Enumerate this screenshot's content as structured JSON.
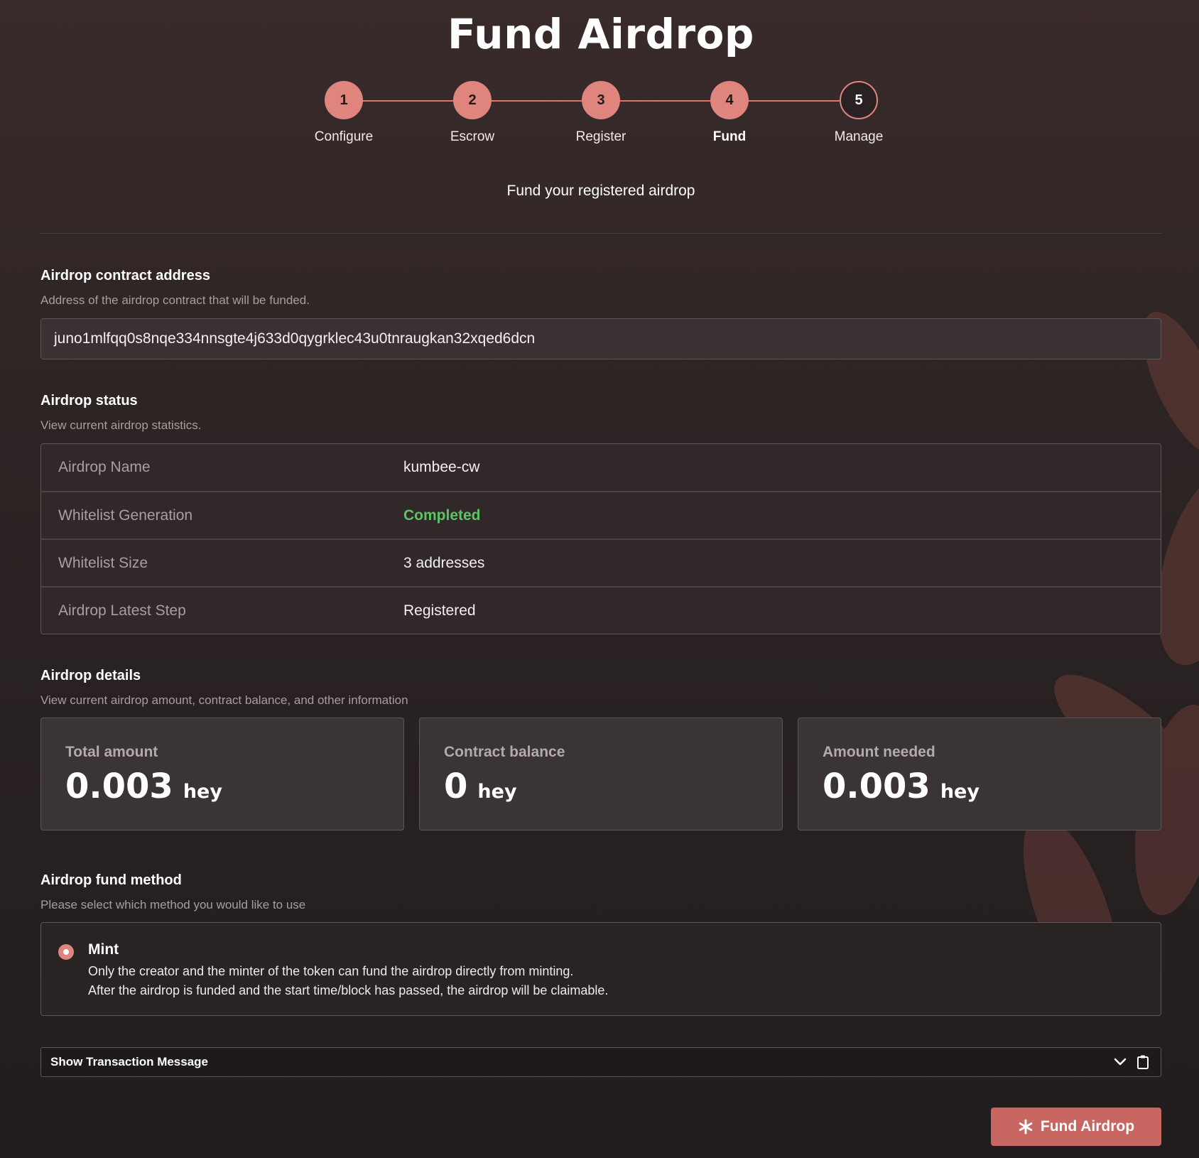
{
  "page": {
    "title": "Fund Airdrop",
    "subtitle": "Fund your registered airdrop"
  },
  "stepper": {
    "steps": [
      {
        "number": "1",
        "label": "Configure",
        "state": "done"
      },
      {
        "number": "2",
        "label": "Escrow",
        "state": "done"
      },
      {
        "number": "3",
        "label": "Register",
        "state": "done"
      },
      {
        "number": "4",
        "label": "Fund",
        "state": "active"
      },
      {
        "number": "5",
        "label": "Manage",
        "state": "upcoming"
      }
    ]
  },
  "contract": {
    "title": "Airdrop contract address",
    "description": "Address of the airdrop contract that will be funded.",
    "address": "juno1mlfqq0s8nqe334nnsgte4j633d0qygrklec43u0tnraugkan32xqed6dcn"
  },
  "status": {
    "title": "Airdrop status",
    "description": "View current airdrop statistics.",
    "rows": [
      {
        "key": "Airdrop Name",
        "value": "kumbee-cw"
      },
      {
        "key": "Whitelist Generation",
        "value": "Completed"
      },
      {
        "key": "Whitelist Size",
        "value": "3 addresses"
      },
      {
        "key": "Airdrop Latest Step",
        "value": "Registered"
      }
    ]
  },
  "details": {
    "title": "Airdrop details",
    "description": "View current airdrop amount, contract balance, and other information",
    "cards": [
      {
        "label": "Total amount",
        "value": "0.003",
        "unit": "hey"
      },
      {
        "label": "Contract balance",
        "value": "0",
        "unit": "hey"
      },
      {
        "label": "Amount needed",
        "value": "0.003",
        "unit": "hey"
      }
    ]
  },
  "fund_method": {
    "title": "Airdrop fund method",
    "description": "Please select which method you would like to use",
    "option": {
      "label": "Mint",
      "line1": "Only the creator and the minter of the token can fund the airdrop directly from minting.",
      "line2": "After the airdrop is funded and the start time/block has passed, the airdrop will be claimable.",
      "selected": true
    }
  },
  "transaction": {
    "label": "Show Transaction Message",
    "icons": [
      "chevron-down-icon",
      "clipboard-icon"
    ]
  },
  "action": {
    "label": "Fund Airdrop",
    "icon": "asterisk-icon"
  },
  "colors": {
    "accent": "#e0857d",
    "button": "#c86661",
    "success": "#5bc466"
  }
}
